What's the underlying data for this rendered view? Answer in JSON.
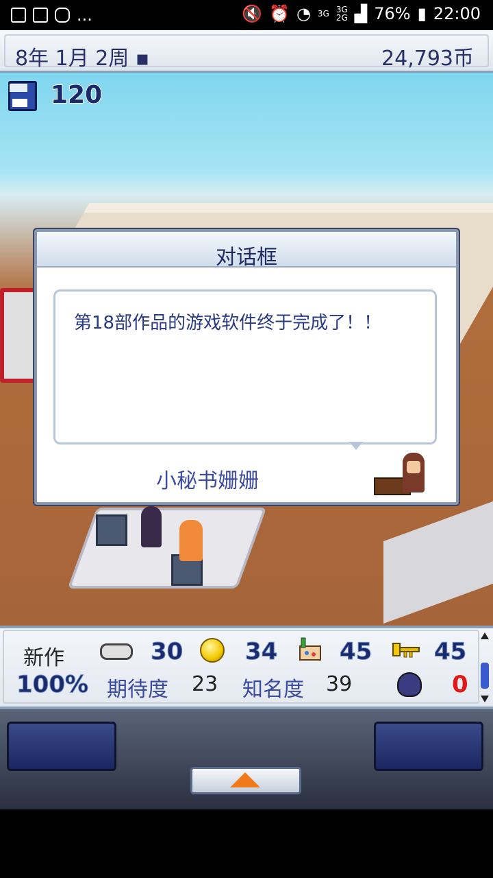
{
  "status_bar": {
    "left_extra": "...",
    "network_1": "3G",
    "network_2": "3G",
    "network_3": "2G",
    "battery": "76%",
    "time": "22:00"
  },
  "top_bar": {
    "date": "8年 1月 2周 ▪",
    "money": "24,793币"
  },
  "save": {
    "count": "120"
  },
  "dialog": {
    "title": "对话框",
    "message": "第18部作品的游戏软件终于完成了！！",
    "speaker": "小秘书姗姗"
  },
  "stats": {
    "new_work_label": "新作",
    "progress": "100%",
    "fun": "30",
    "creativity": "34",
    "graphics": "45",
    "sound": "45",
    "expectation_label": "期待度",
    "expectation_value": "23",
    "fame_label": "知名度",
    "fame_value": "39",
    "bugs": "0",
    "icons": [
      "gamepad-icon",
      "coin-icon",
      "art-icon",
      "sound-icon",
      "bug-icon"
    ]
  },
  "colors": {
    "title_text": "#28306a",
    "accent_orange": "#f07a1a",
    "bug_red": "#e01818"
  }
}
